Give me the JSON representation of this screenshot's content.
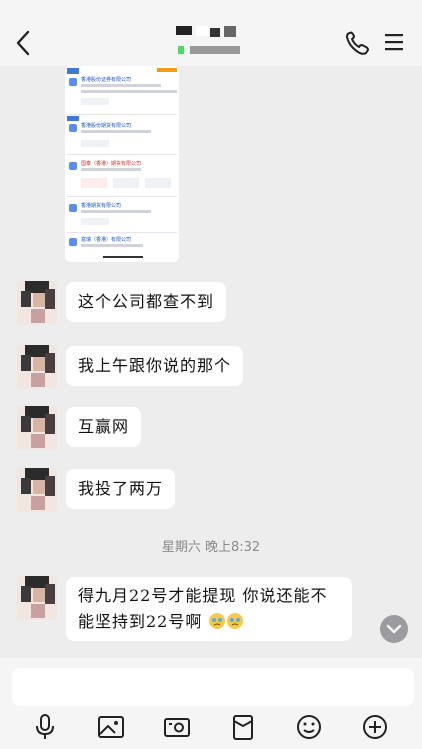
{
  "header": {
    "title_redacted": "",
    "subtitle_redacted": ""
  },
  "messages": [
    {
      "side": "left",
      "text": "这个公司都查不到"
    },
    {
      "side": "left",
      "text": "我上午跟你说的那个"
    },
    {
      "side": "left",
      "text": "互赢网"
    },
    {
      "side": "left",
      "text": "我投了两万"
    },
    {
      "side": "left",
      "text": "得九月22号才能提现 你说还能不能坚持到22号啊"
    }
  ],
  "timestamp": "星期六 晚上8:32",
  "input": {
    "placeholder": ""
  },
  "shared_screenshot": {
    "rows": [
      {
        "name": "香港股份证券有限公司"
      },
      {
        "name": "香港股份期货有限公司"
      },
      {
        "name": "国泰（香港）期货有限公司"
      },
      {
        "name": "香港期货有限公司"
      },
      {
        "name": "富瑞（香港）有限公司"
      }
    ]
  }
}
